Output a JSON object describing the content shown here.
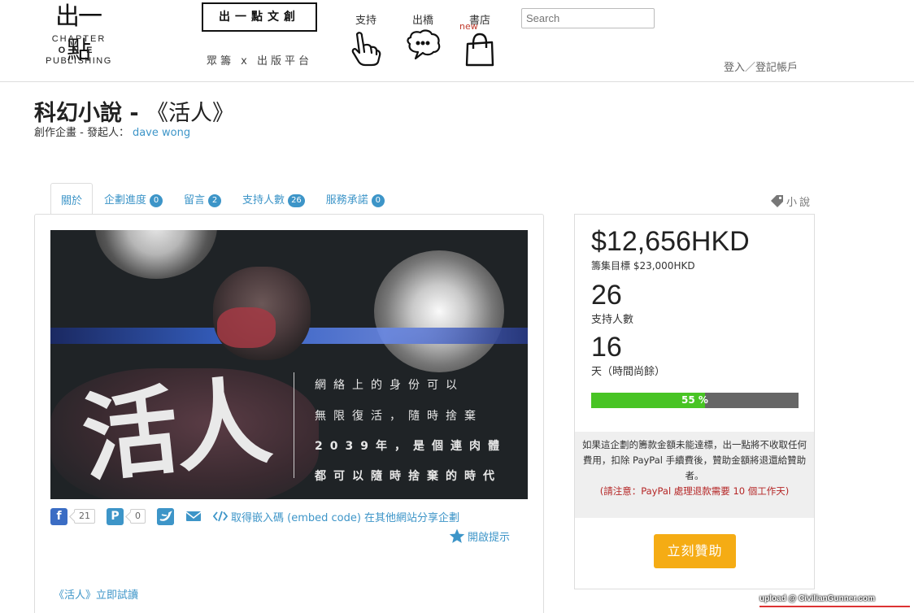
{
  "header": {
    "logo": {
      "mark": "出一點",
      "line1": "CHAPTER",
      "line2": "ONE",
      "line3": "PUBLISHING"
    },
    "brand_title": "出一點文創",
    "brand_subtitle": "眾籌 x 出版平台",
    "nav": [
      {
        "label": "支持",
        "icon": "hand-pointer-icon"
      },
      {
        "label": "出橋",
        "icon": "speech-bubble-icon"
      },
      {
        "label": "書店",
        "badge": "new",
        "icon": "shopping-bag-icon"
      }
    ],
    "search_placeholder": "Search",
    "login": "登入／登記帳戶"
  },
  "project": {
    "title_prefix": "科幻小說 - ",
    "title_main": "《活人》",
    "byline_label": "創作企畫 - 發起人：",
    "author": "dave wong",
    "category": "小說"
  },
  "tabs": [
    {
      "label": "關於",
      "active": true
    },
    {
      "label": "企劃進度",
      "count": "0"
    },
    {
      "label": "留言",
      "count": "2"
    },
    {
      "label": "支持人數",
      "count": "26"
    },
    {
      "label": "服務承諾",
      "count": "0"
    }
  ],
  "hero": {
    "calligraphy": "活人",
    "lines": [
      "網絡上的身份可以",
      "無限復活，隨時捨棄",
      "2039年，是個連肉體",
      "都可以隨時捨棄的時代"
    ]
  },
  "share": {
    "facebook_count": "21",
    "pinterest_count": "0",
    "embed_label": "取得嵌入碼 (embed code) 在其他網站分享企劃",
    "hint_label": "開啟提示"
  },
  "trial_link": "《活人》立即試讀",
  "funding": {
    "amount": "$12,656HKD",
    "goal": "籌集目標 $23,000HKD",
    "backers": "26",
    "backers_label": "支持人數",
    "days": "16",
    "days_label": "天（時間尚餘）",
    "progress_percent": 55,
    "progress_label": "55 %",
    "notice": "如果這企劃的籌款金額未能達標，出一點將不收取任何費用，扣除 PayPal 手續費後，贊助金額將退還給贊助者。",
    "notice_warning": "(請注意：PayPal 處理退款需要 10 個工作天)",
    "support_button": "立刻贊助"
  },
  "watermark": "upload @ CivilianGunner.com",
  "colors": {
    "link": "#3d95c8",
    "progress": "#48c424",
    "button": "#f5ac14",
    "warning": "#b52626"
  }
}
